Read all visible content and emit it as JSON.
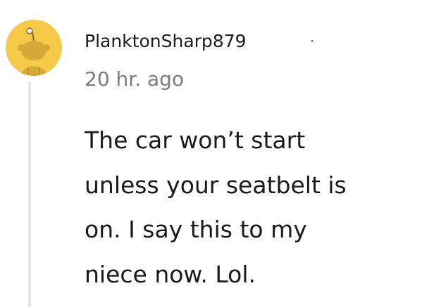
{
  "comment": {
    "username": "PlanktonSharp879",
    "separator": "·",
    "timestamp": "20 hr. ago",
    "avatar_icon": "reddit-snoo-icon",
    "avatar_color": "#f7c948",
    "body_lines": [
      "The car won’t start",
      "unless your seatbelt is",
      "on. I say this to my",
      "niece now. Lol."
    ]
  }
}
